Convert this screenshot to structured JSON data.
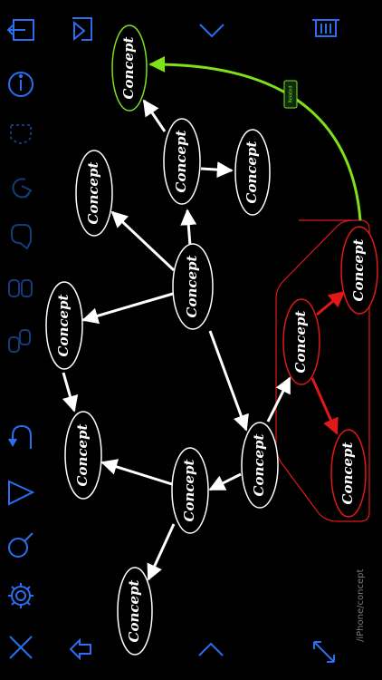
{
  "colors": {
    "background": "#000000",
    "toolbar_icon": "#2a6ff0",
    "toolbar_dim": "#173a7a",
    "concept_default": "#ffffff",
    "concept_red": "#e01818",
    "concept_green": "#7ee21a",
    "group_outline": "#e01818"
  },
  "toolbar_left": {
    "items": [
      {
        "name": "exit-icon"
      },
      {
        "name": "info-icon"
      },
      {
        "name": "lasso-icon"
      },
      {
        "name": "shape-rotate-icon"
      },
      {
        "name": "speech-bubble-icon"
      },
      {
        "name": "duplicate-icon"
      },
      {
        "name": "group-icon"
      },
      {
        "name": "undo-icon"
      },
      {
        "name": "send-icon"
      },
      {
        "name": "search-icon"
      },
      {
        "name": "settings-gear-icon"
      },
      {
        "name": "close-icon"
      }
    ]
  },
  "toolbar_bottom": {
    "items": [
      {
        "name": "back-arrow-icon"
      },
      {
        "name": "chevron-up-icon"
      },
      {
        "name": "expand-icon"
      }
    ]
  },
  "toolbar_top": {
    "items": [
      {
        "name": "import-icon"
      },
      {
        "name": "chevron-down-icon"
      },
      {
        "name": "trash-icon"
      }
    ]
  },
  "map": {
    "concepts": [
      {
        "id": "c_top_green",
        "label": "Concept"
      },
      {
        "id": "c_upper_mid",
        "label": "Concept"
      },
      {
        "id": "c_upper_right",
        "label": "Concept"
      },
      {
        "id": "c_left_high",
        "label": "Concept"
      },
      {
        "id": "c_center",
        "label": "Concept"
      },
      {
        "id": "c_left_mid",
        "label": "Concept"
      },
      {
        "id": "c_left_low",
        "label": "Concept"
      },
      {
        "id": "c_mid_low",
        "label": "Concept"
      },
      {
        "id": "c_right_low",
        "label": "Concept"
      },
      {
        "id": "c_bottom_left",
        "label": "Concept"
      },
      {
        "id": "c_red_center",
        "label": "Concept"
      },
      {
        "id": "c_red_top",
        "label": "Concept"
      },
      {
        "id": "c_red_bottom",
        "label": "Concept"
      }
    ],
    "link_label": "Related"
  },
  "watermark": "/iPhone/concept"
}
